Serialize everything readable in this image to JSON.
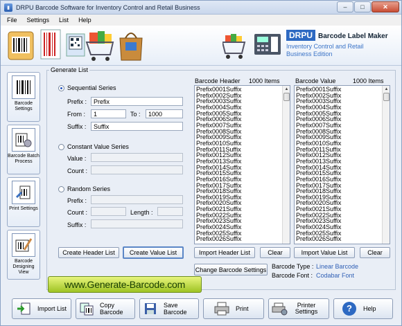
{
  "window": {
    "title": "DRPU Barcode Software for Inventory Control and Retail Business"
  },
  "menu": [
    "File",
    "Settings",
    "List",
    "Help"
  ],
  "brand": {
    "logo": "DRPU",
    "title": "Barcode Label Maker",
    "subtitle_line1": "Inventory Control and Retail",
    "subtitle_line2": "Business Edition"
  },
  "sidebar": [
    {
      "label": "Barcode Settings",
      "icon": "barcode-settings-icon"
    },
    {
      "label": "Barcode Batch Process",
      "icon": "batch-process-icon"
    },
    {
      "label": "Print Settings",
      "icon": "print-settings-icon"
    },
    {
      "label": "Barcode Designing View",
      "icon": "designing-view-icon"
    }
  ],
  "generate": {
    "group_label": "Generate List",
    "sequential": {
      "label": "Sequential Series",
      "selected": true,
      "prefix_label": "Prefix :",
      "prefix": "Prefix",
      "from_label": "From :",
      "from": "1",
      "to_label": "To :",
      "to": "1000",
      "suffix_label": "Suffix :",
      "suffix": "Suffix"
    },
    "constant": {
      "label": "Constant Value Series",
      "selected": false,
      "value_label": "Value :",
      "count_label": "Count :"
    },
    "random": {
      "label": "Random Series",
      "selected": false,
      "prefix_label": "Prefix :",
      "count_label": "Count :",
      "length_label": "Length :",
      "suffix_label": "Suffix :"
    },
    "create_header_label": "Create Header List",
    "create_value_label": "Create Value List"
  },
  "header_list": {
    "title": "Barcode Header",
    "count": "1000 Items",
    "import_label": "Import Header List",
    "clear_label": "Clear",
    "items": [
      "Prefix0001Suffix",
      "Prefix0002Suffix",
      "Prefix0003Suffix",
      "Prefix0004Suffix",
      "Prefix0005Suffix",
      "Prefix0006Suffix",
      "Prefix0007Suffix",
      "Prefix0008Suffix",
      "Prefix0009Suffix",
      "Prefix0010Suffix",
      "Prefix0011Suffix",
      "Prefix0012Suffix",
      "Prefix0013Suffix",
      "Prefix0014Suffix",
      "Prefix0015Suffix",
      "Prefix0016Suffix",
      "Prefix0017Suffix",
      "Prefix0018Suffix",
      "Prefix0019Suffix",
      "Prefix0020Suffix",
      "Prefix0021Suffix",
      "Prefix0022Suffix",
      "Prefix0023Suffix",
      "Prefix0024Suffix",
      "Prefix0025Suffix",
      "Prefix0026Suffix"
    ]
  },
  "value_list": {
    "title": "Barcode Value",
    "count": "1000 Items",
    "import_label": "Import Value List",
    "clear_label": "Clear",
    "items": [
      "Prefix0001Suffix",
      "Prefix0002Suffix",
      "Prefix0003Suffix",
      "Prefix0004Suffix",
      "Prefix0005Suffix",
      "Prefix0006Suffix",
      "Prefix0007Suffix",
      "Prefix0008Suffix",
      "Prefix0009Suffix",
      "Prefix0010Suffix",
      "Prefix0011Suffix",
      "Prefix0012Suffix",
      "Prefix0013Suffix",
      "Prefix0014Suffix",
      "Prefix0015Suffix",
      "Prefix0016Suffix",
      "Prefix0017Suffix",
      "Prefix0018Suffix",
      "Prefix0019Suffix",
      "Prefix0020Suffix",
      "Prefix0021Suffix",
      "Prefix0022Suffix",
      "Prefix0023Suffix",
      "Prefix0024Suffix",
      "Prefix0025Suffix",
      "Prefix0026Suffix"
    ]
  },
  "change_settings_label": "Change Barcode Settings",
  "barcode_info": {
    "type_label": "Barcode Type :",
    "type": "Linear Barcode",
    "font_label": "Barcode Font :",
    "font": "Codabar Font"
  },
  "website": "www.Generate-Barcode.com",
  "bottom_buttons": [
    {
      "label": "Import List",
      "icon": "import-list-icon"
    },
    {
      "label": "Copy Barcode",
      "icon": "copy-barcode-icon"
    },
    {
      "label": "Save Barcode",
      "icon": "save-icon"
    },
    {
      "label": "Print",
      "icon": "printer-icon"
    },
    {
      "label": "Printer Settings",
      "icon": "printer-settings-icon"
    },
    {
      "label": "Help",
      "icon": "help-icon"
    }
  ],
  "colors": {
    "accent": "#2d69c2",
    "link": "#2f5fb5",
    "website_bg": "#b5d93a"
  }
}
